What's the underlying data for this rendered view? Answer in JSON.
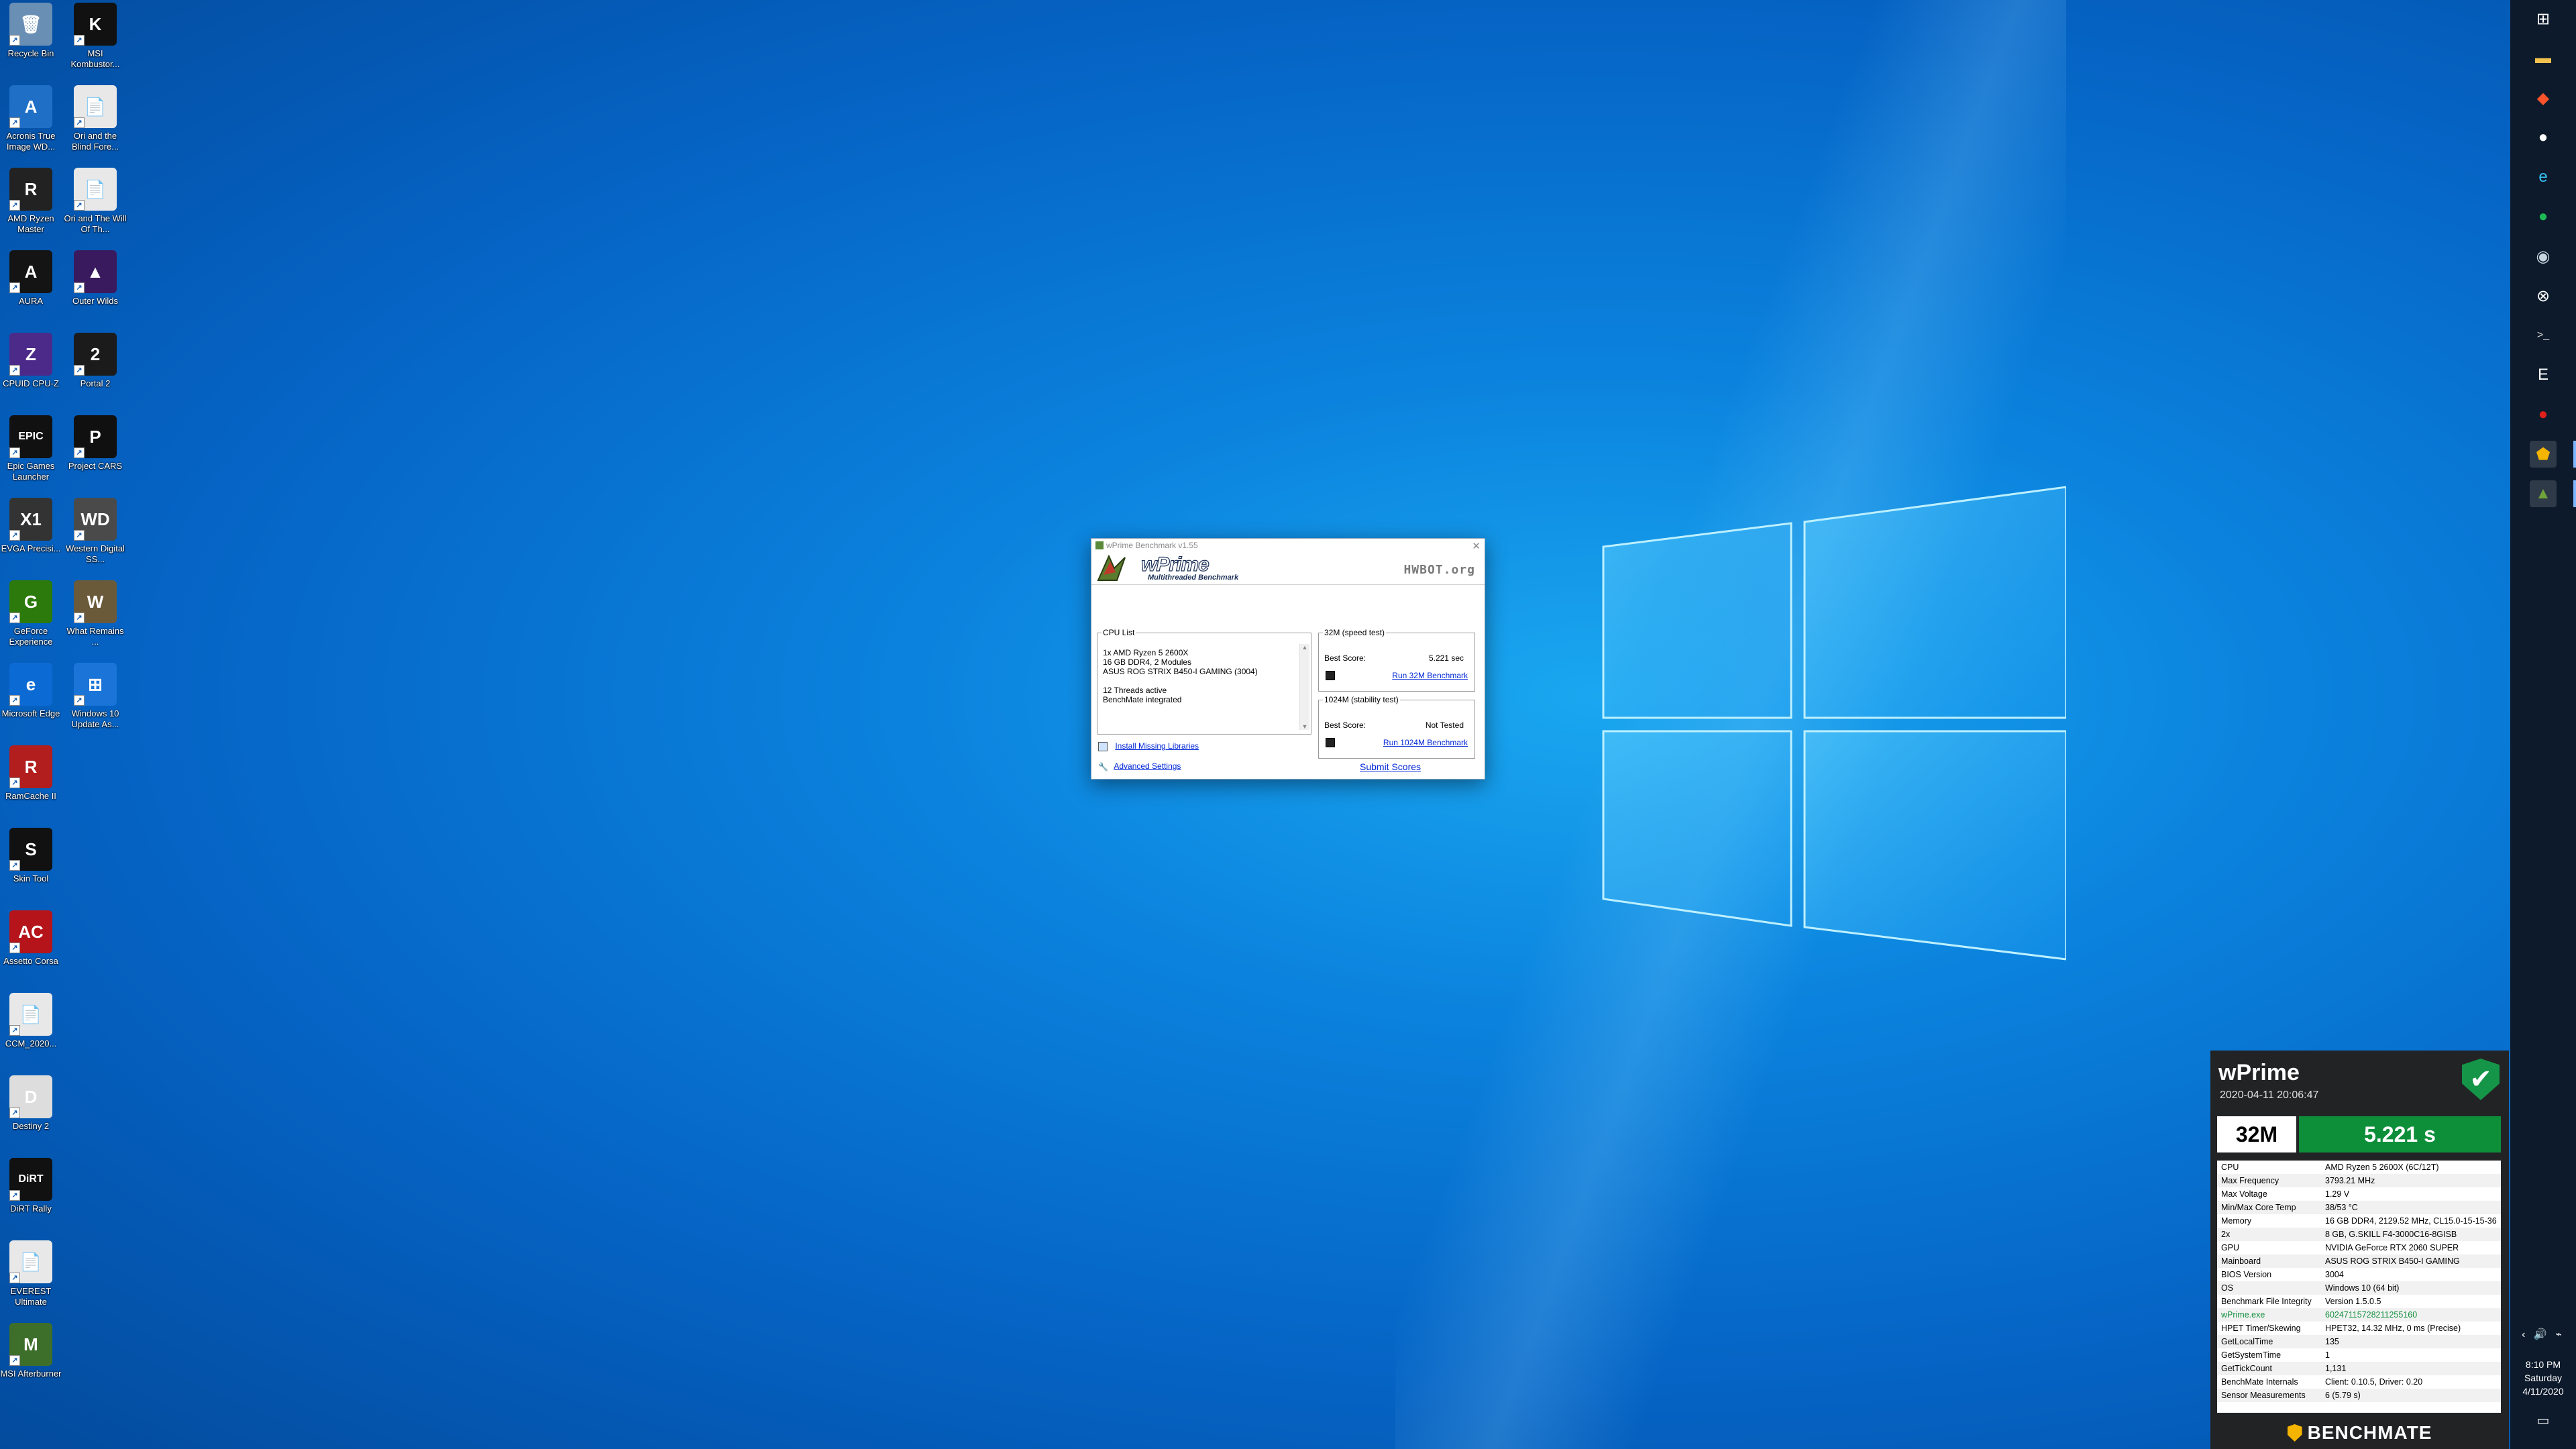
{
  "desktop": {
    "icons_col1": [
      {
        "label": "Recycle Bin",
        "glyph": "🗑",
        "color": "#6a8fb5"
      },
      {
        "label": "Acronis True Image WD...",
        "glyph": "A",
        "color": "#1f6fc6"
      },
      {
        "label": "AMD Ryzen Master",
        "glyph": "R",
        "color": "#222"
      },
      {
        "label": "AURA",
        "glyph": "A",
        "color": "#141414"
      },
      {
        "label": "CPUID CPU-Z",
        "glyph": "Z",
        "color": "#4b2a8a"
      },
      {
        "label": "Epic Games Launcher",
        "glyph": "EPIC",
        "color": "#111"
      },
      {
        "label": "EVGA Precisi...",
        "glyph": "X1",
        "color": "#333"
      },
      {
        "label": "GeForce Experience",
        "glyph": "G",
        "color": "#2b7a0b"
      },
      {
        "label": "Microsoft Edge",
        "glyph": "e",
        "color": "#0c6ad4"
      },
      {
        "label": "RamCache II",
        "glyph": "R",
        "color": "#b21d1d"
      },
      {
        "label": "Skin Tool",
        "glyph": "S",
        "color": "#111"
      },
      {
        "label": "Assetto Corsa",
        "glyph": "AC",
        "color": "#b4141a"
      },
      {
        "label": "CCM_2020...",
        "glyph": "📄",
        "color": "#e8e8e8"
      },
      {
        "label": "Destiny 2",
        "glyph": "D",
        "color": "#dddddd"
      },
      {
        "label": "DiRT Rally",
        "glyph": "DiRT",
        "color": "#111"
      },
      {
        "label": "EVEREST Ultimate",
        "glyph": "📄",
        "color": "#e8e8e8"
      },
      {
        "label": "MSI Afterburner",
        "glyph": "M",
        "color": "#3d6e2a"
      }
    ],
    "icons_col2": [
      {
        "label": "MSI Kombustor...",
        "glyph": "K",
        "color": "#111"
      },
      {
        "label": "Ori and the Blind Fore...",
        "glyph": "📄",
        "color": "#e8e8e8"
      },
      {
        "label": "Ori and The Will Of Th...",
        "glyph": "📄",
        "color": "#e8e8e8"
      },
      {
        "label": "Outer Wilds",
        "glyph": "▲",
        "color": "#3a1a5e"
      },
      {
        "label": "Portal 2",
        "glyph": "2",
        "color": "#1b1b1b"
      },
      {
        "label": "Project CARS",
        "glyph": "P",
        "color": "#101010"
      },
      {
        "label": "Western Digital SS...",
        "glyph": "WD",
        "color": "#4a4a4a"
      },
      {
        "label": "What Remains ...",
        "glyph": "W",
        "color": "#6b5a3a"
      },
      {
        "label": "Windows 10 Update As...",
        "glyph": "⊞",
        "color": "#1b74d8"
      }
    ]
  },
  "wprime": {
    "window_title": "wPrime Benchmark v1.55",
    "logo_main": "wPrime",
    "logo_sub": "Multithreaded Benchmark",
    "hwbot_logo": "HWBOT.org",
    "cpu_list_label": "CPU List",
    "cpu_lines": [
      "1x AMD Ryzen 5 2600X",
      "16 GB DDR4, 2 Modules",
      "ASUS ROG STRIX B450-I GAMING (3004)",
      "",
      "12 Threads active",
      "BenchMate integrated"
    ],
    "install_libraries": "Install Missing Libraries",
    "advanced_settings": "Advanced Settings",
    "speed_test_label": "32M (speed test)",
    "speed_best_label": "Best Score:",
    "speed_best_value": "5.221 sec",
    "run_32m": "Run 32M Benchmark",
    "stability_label": "1024M (stability test)",
    "stability_best_label": "Best Score:",
    "stability_best_value": "Not Tested",
    "run_1024m": "Run 1024M Benchmark",
    "submit_scores": "Submit Scores"
  },
  "benchmate": {
    "title": "wPrime",
    "date": "2020-04-11 20:06:47",
    "test": "32M",
    "score": "5.221 s",
    "rows": [
      {
        "k": "CPU",
        "v": "AMD Ryzen 5 2600X (6C/12T)"
      },
      {
        "k": "Max Frequency",
        "v": "3793.21 MHz"
      },
      {
        "k": "Max Voltage",
        "v": "1.29 V"
      },
      {
        "k": "Min/Max Core Temp",
        "v": "38/53 °C"
      },
      {
        "k": "Memory",
        "v": "16 GB DDR4, 2129.52 MHz, CL15.0-15-15-36"
      },
      {
        "k": "2x",
        "v": "8 GB, G.SKILL F4-3000C16-8GISB"
      },
      {
        "k": "GPU",
        "v": "NVIDIA GeForce RTX 2060 SUPER"
      },
      {
        "k": "Mainboard",
        "v": "ASUS ROG STRIX B450-I GAMING"
      },
      {
        "k": "BIOS Version",
        "v": "3004"
      },
      {
        "k": "OS",
        "v": "Windows 10 (64 bit)"
      },
      {
        "k": "Benchmark File Integrity",
        "v": "Version 1.5.0.5"
      },
      {
        "k": "wPrime.exe",
        "v": "60247115728211255160"
      },
      {
        "k": "HPET Timer/Skewing",
        "v": "HPET32, 14.32 MHz, 0 ms (Precise)"
      },
      {
        "k": "GetLocalTime",
        "v": "135"
      },
      {
        "k": "GetSystemTime",
        "v": "1"
      },
      {
        "k": "GetTickCount",
        "v": "1,131"
      },
      {
        "k": "BenchMate Internals",
        "v": "Client: 0.10.5, Driver: 0.20"
      },
      {
        "k": "Sensor Measurements",
        "v": "6 (5.79 s)"
      }
    ],
    "footer": "BENCHMATE"
  },
  "taskbar": {
    "icons": [
      "windows-start-icon",
      "file-explorer-icon",
      "brave-icon",
      "github-icon",
      "edge-icon",
      "spotify-icon",
      "steam-icon",
      "xbox-icon",
      "terminal-icon",
      "epic-icon",
      "red-app-icon",
      "benchmate-icon",
      "wprime-icon"
    ],
    "time": "8:10 PM",
    "day": "Saturday",
    "date": "4/11/2020"
  }
}
